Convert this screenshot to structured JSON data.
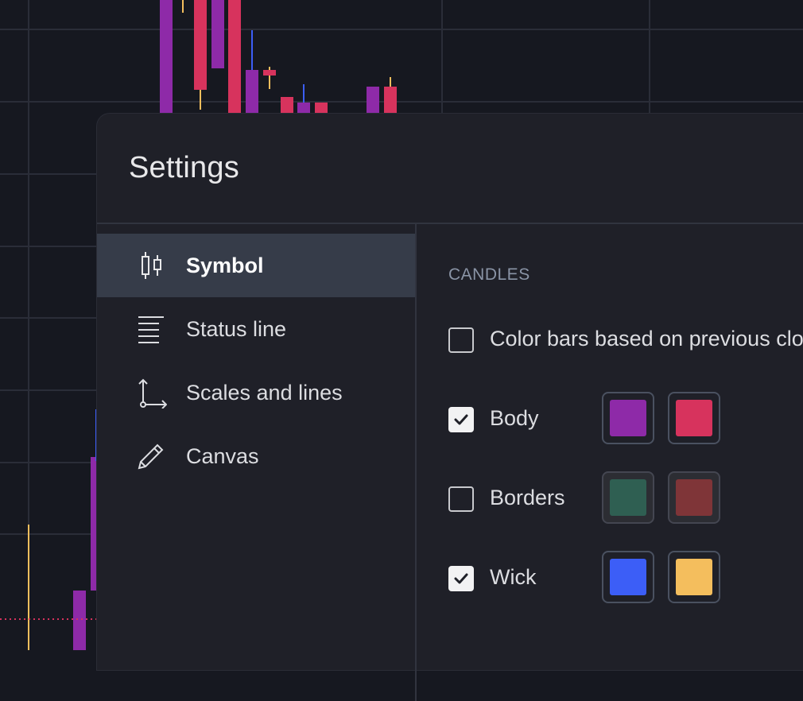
{
  "dialog": {
    "title": "Settings"
  },
  "sidebar": {
    "items": [
      {
        "label": "Symbol",
        "icon": "candles-icon",
        "active": true
      },
      {
        "label": "Status line",
        "icon": "status-line-icon",
        "active": false
      },
      {
        "label": "Scales and lines",
        "icon": "axes-icon",
        "active": false
      },
      {
        "label": "Canvas",
        "icon": "pencil-icon",
        "active": false
      }
    ]
  },
  "candles": {
    "section_title": "CANDLES",
    "color_prev_close": {
      "label": "Color bars based on previous close",
      "checked": false
    },
    "body": {
      "label": "Body",
      "checked": true,
      "up_color": "#8e2aa8",
      "down_color": "#d7335d"
    },
    "borders": {
      "label": "Borders",
      "checked": false,
      "up_color": "#2f5f52",
      "down_color": "#7f3538"
    },
    "wick": {
      "label": "Wick",
      "checked": true,
      "up_color": "#3c5ef7",
      "down_color": "#f4be5d"
    }
  },
  "colors": {
    "background": "#161820",
    "dialog": "#1f2028",
    "active_nav": "#363c49",
    "grid": "#2a2d38"
  }
}
